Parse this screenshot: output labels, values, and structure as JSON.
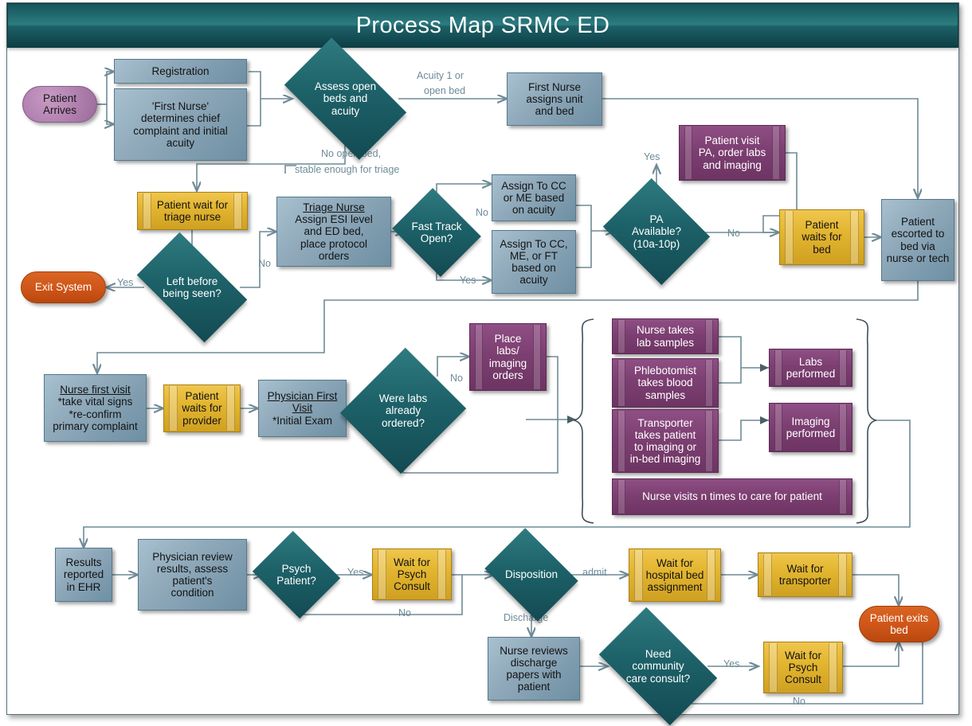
{
  "header": {
    "title": "Process Map SRMC ED"
  },
  "colors": {
    "banner_dark": "#15545b",
    "process_blue": "#6e8fa3",
    "decision_teal": "#1d6168",
    "wait_gold": "#e3b630",
    "activity_purple": "#7d3f72",
    "start_mauve": "#b07fae",
    "exit_orange": "#cf5518",
    "connector": "#6f8a96"
  },
  "nodes": {
    "patient_arrives": "Patient\nArrives",
    "registration": "Registration",
    "first_nurse": "'First Nurse' determines chief complaint and initial acuity",
    "assess_open_beds": "Assess open beds and acuity",
    "first_nurse_assigns": "First Nurse assigns unit and bed",
    "patient_wait_triage": "Patient wait for triage nurse",
    "triage_nurse_title": "Triage Nurse",
    "triage_nurse_body": "Assign ESI level and ED bed, place protocol orders",
    "left_before_seen": "Left before being seen?",
    "exit_system": "Exit System",
    "fast_track_open": "Fast Track Open?",
    "assign_cc_me": "Assign To CC or ME based on acuity",
    "assign_cc_me_ft": "Assign To CC, ME, or FT based on acuity",
    "pa_available": "PA Available? (10a-10p)",
    "patient_visit_pa": "Patient visit PA, order labs and imaging",
    "patient_waits_bed": "Patient waits for bed",
    "patient_escorted": "Patient escorted to bed via nurse or tech",
    "nurse_first_visit_title": "Nurse first visit",
    "nurse_first_visit_body": "*take vital signs *re-confirm primary complaint",
    "patient_waits_provider": "Patient waits for provider",
    "physician_first_visit_title": "Physician First Visit",
    "physician_first_visit_body": "*Initial Exam",
    "were_labs_ordered": "Were labs already ordered?",
    "place_labs_orders": "Place labs/ imaging orders",
    "nurse_takes_lab": "Nurse takes lab samples",
    "phlebotomist": "Phlebotomist takes blood samples",
    "transporter": "Transporter takes patient to imaging or in-bed imaging",
    "nurse_visits_n": "Nurse visits n times to care for patient",
    "labs_performed": "Labs performed",
    "imaging_performed": "Imaging performed",
    "results_reported": "Results reported in EHR",
    "physician_review": "Physician review results, assess patient's condition",
    "psych_patient": "Psych Patient?",
    "wait_psych_consult_1": "Wait for Psych Consult",
    "disposition": "Disposition",
    "wait_hospital_bed": "Wait for hospital bed assignment",
    "wait_transporter": "Wait for transporter",
    "patient_exits_bed": "Patient exits bed",
    "nurse_reviews_discharge": "Nurse reviews discharge papers with patient",
    "need_community_care": "Need community care consult?",
    "wait_psych_consult_2": "Wait for Psych Consult"
  },
  "node_lines": {
    "patient_arrives": [
      "Patient",
      "Arrives"
    ],
    "first_nurse": [
      "'First Nurse'",
      "determines chief",
      "complaint and initial",
      "acuity"
    ],
    "assess_open_beds": [
      "Assess open",
      "beds and",
      "acuity"
    ],
    "first_nurse_assigns": [
      "First Nurse",
      "assigns unit",
      "and bed"
    ],
    "patient_wait_triage": [
      "Patient wait for",
      "triage nurse"
    ],
    "triage_nurse_body": [
      "Assign ESI level",
      "and ED bed,",
      "place protocol",
      "orders"
    ],
    "left_before_seen": [
      "Left before",
      "being seen?"
    ],
    "fast_track_open": [
      "Fast Track",
      "Open?"
    ],
    "assign_cc_me": [
      "Assign To CC",
      "or ME based",
      "on acuity"
    ],
    "assign_cc_me_ft": [
      "Assign To CC,",
      "ME, or FT",
      "based on",
      "acuity"
    ],
    "pa_available": [
      "PA",
      "Available?",
      "(10a-10p)"
    ],
    "patient_visit_pa": [
      "Patient visit",
      "PA, order labs",
      "and imaging"
    ],
    "patient_waits_bed": [
      "Patient",
      "waits for",
      "bed"
    ],
    "patient_escorted": [
      "Patient",
      "escorted to",
      "bed via",
      "nurse or tech"
    ],
    "nurse_first_visit_body": [
      "*take vital signs",
      "*re-confirm",
      "primary complaint"
    ],
    "patient_waits_provider": [
      "Patient",
      "waits for",
      "provider"
    ],
    "physician_first_visit_title": [
      "Physician First",
      "Visit"
    ],
    "were_labs_ordered": [
      "Were labs",
      "already",
      "ordered?"
    ],
    "place_labs_orders": [
      "Place",
      "labs/",
      "imaging",
      "orders"
    ],
    "nurse_takes_lab": [
      "Nurse takes",
      "lab samples"
    ],
    "phlebotomist": [
      "Phlebotomist",
      "takes blood",
      "samples"
    ],
    "transporter": [
      "Transporter",
      "takes patient",
      "to imaging or",
      "in-bed imaging"
    ],
    "labs_performed": [
      "Labs",
      "performed"
    ],
    "imaging_performed": [
      "Imaging",
      "performed"
    ],
    "results_reported": [
      "Results",
      "reported",
      "in EHR"
    ],
    "physician_review": [
      "Physician review",
      "results, assess",
      "patient's",
      "condition"
    ],
    "psych_patient": [
      "Psych",
      "Patient?"
    ],
    "wait_psych_consult_1": [
      "Wait for",
      "Psych",
      "Consult"
    ],
    "wait_hospital_bed": [
      "Wait for",
      "hospital bed",
      "assignment"
    ],
    "wait_transporter": [
      "Wait for",
      "transporter"
    ],
    "patient_exits_bed": [
      "Patient exits",
      "bed"
    ],
    "nurse_reviews_discharge": [
      "Nurse reviews",
      "discharge",
      "papers with",
      "patient"
    ],
    "need_community_care": [
      "Need",
      "community",
      "care consult?"
    ],
    "wait_psych_consult_2": [
      "Wait for",
      "Psych",
      "Consult"
    ]
  },
  "edge_labels": {
    "acuity_open_bed_l1": "Acuity 1 or",
    "acuity_open_bed_l2": "open bed",
    "no_open_bed_l1": "No open bed,",
    "no_open_bed_l2": "stable enough for triage",
    "left_yes": "Yes",
    "left_no": "No",
    "fast_track_no": "No",
    "fast_track_yes": "Yes",
    "pa_yes": "Yes",
    "pa_no": "No",
    "labs_no": "No",
    "psych_yes": "Yes",
    "psych_no": "No",
    "disposition_admit": "admit",
    "disposition_discharge": "Discharge",
    "community_yes": "Yes",
    "community_no": "No"
  }
}
